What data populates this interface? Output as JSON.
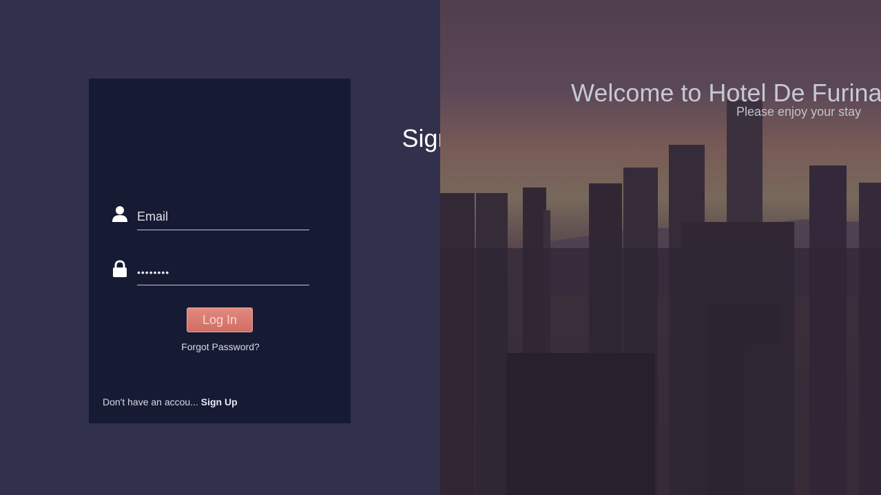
{
  "login": {
    "title": "Sign In",
    "email_placeholder": "Email",
    "password_value": "********",
    "login_label": "Log In",
    "forgot_label": "Forgot Password?",
    "signup_prompt": "Don't have an accou...",
    "signup_label": "Sign Up"
  },
  "hero": {
    "title": "Welcome to Hotel De Furina",
    "subtitle": "Please enjoy your stay"
  },
  "icons": {
    "email": "user-icon",
    "password": "lock-icon"
  },
  "colors": {
    "page_background": "#31304d",
    "card_background": "#161a33",
    "button_accent": "#d9786e",
    "text_primary": "#ffffff"
  }
}
